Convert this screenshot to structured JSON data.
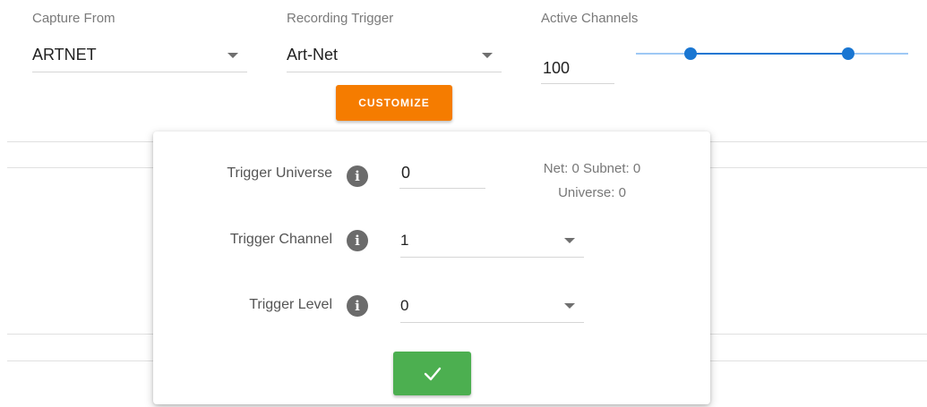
{
  "capture_from": {
    "label": "Capture From",
    "value": "ARTNET"
  },
  "recording_trigger": {
    "label": "Recording Trigger",
    "value": "Art-Net"
  },
  "active_channels": {
    "label": "Active Channels",
    "value": "100"
  },
  "channel_range_slider": {
    "low": 0.2,
    "high": 0.78
  },
  "customize_label": "CUSTOMIZE",
  "colors": {
    "accent_orange": "#f57c00",
    "slider_blue": "#1976d2",
    "confirm_green": "#4caf50"
  },
  "trigger_popup": {
    "universe": {
      "label": "Trigger Universe",
      "value": "0",
      "icon": "info-icon"
    },
    "net_info_line1": "Net: 0 Subnet: 0",
    "net_info_line2": "Universe: 0",
    "channel": {
      "label": "Trigger Channel",
      "value": "1",
      "icon": "info-icon"
    },
    "level": {
      "label": "Trigger Level",
      "value": "0",
      "icon": "info-icon"
    },
    "confirm_icon": "check-icon"
  }
}
